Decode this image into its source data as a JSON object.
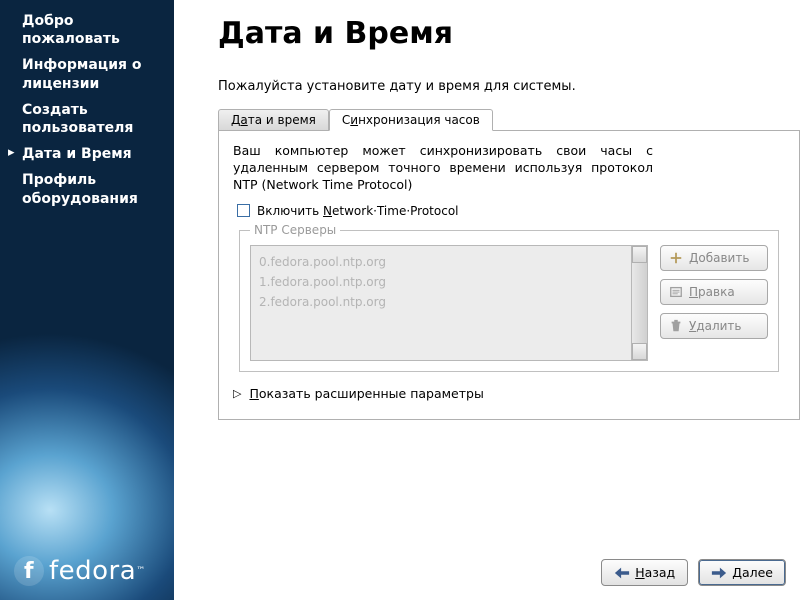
{
  "sidebar": {
    "items": [
      {
        "label": "Добро пожаловать"
      },
      {
        "label": "Информация о лицензии"
      },
      {
        "label": "Создать пользователя"
      },
      {
        "label": "Дата и Время"
      },
      {
        "label": "Профиль оборудования"
      }
    ]
  },
  "logo": {
    "text": "fedora",
    "tm": "™"
  },
  "page": {
    "title": "Дата и Время",
    "intro": "Пожалуйста установите дату и время для системы."
  },
  "tabs": {
    "datetime_pre": "Д",
    "datetime_und": "а",
    "datetime_post": "та и время",
    "sync_pre": "С",
    "sync_und": "и",
    "sync_post": "нхронизация часов"
  },
  "panel": {
    "description": "Ваш компьютер может синхронизировать свои часы с удаленным сервером точного времени используя протокол NTP (Network Time Protocol)",
    "checkbox_pre": "Включить ",
    "checkbox_und": "N",
    "checkbox_post": "etwork·Time·Protocol",
    "legend": "NTP Серверы",
    "servers": [
      "0.fedora.pool.ntp.org",
      "1.fedora.pool.ntp.org",
      "2.fedora.pool.ntp.org"
    ],
    "buttons": {
      "add_und": "Д",
      "add_post": "обавить",
      "edit_und": "П",
      "edit_post": "равка",
      "delete_und": "У",
      "delete_post": "далить"
    },
    "expander_und": "П",
    "expander_post": "оказать расширенные параметры"
  },
  "footer": {
    "back_und": "Н",
    "back_post": "азад",
    "next_und": "Д",
    "next_post": "алее"
  }
}
